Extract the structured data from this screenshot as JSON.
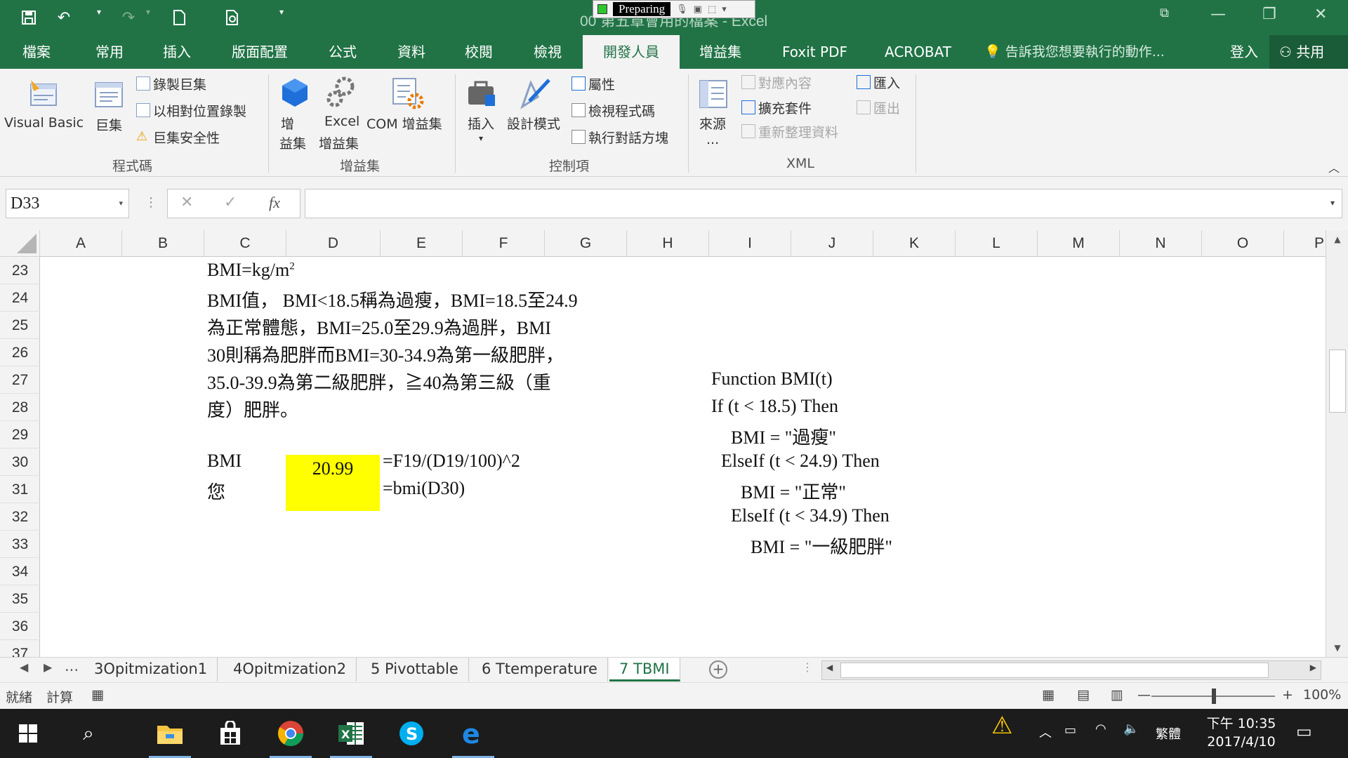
{
  "window": {
    "title": "00 第五章會用的檔案 - Excel",
    "recorder_status": "Preparing"
  },
  "tabs": [
    "檔案",
    "常用",
    "插入",
    "版面配置",
    "公式",
    "資料",
    "校閱",
    "檢視",
    "開發人員",
    "增益集",
    "Foxit PDF",
    "ACROBAT"
  ],
  "active_tab": "開發人員",
  "tell_me": "告訴我您想要執行的動作...",
  "sign_in": "登入",
  "share": "共用",
  "ribbon": {
    "code": {
      "group": "程式碼",
      "visual_basic": "Visual Basic",
      "macros": "巨集",
      "record_macro": "錄製巨集",
      "relative_ref": "以相對位置錄製",
      "macro_security": "巨集安全性"
    },
    "addins": {
      "group": "增益集",
      "addins_line1": "增",
      "addins_line2": "益集",
      "excel_addins_line1": "Excel",
      "excel_addins_line2": "增益集",
      "com_addins": "COM 增益集"
    },
    "controls": {
      "group": "控制項",
      "insert": "插入",
      "design_mode": "設計模式",
      "properties": "屬性",
      "view_code": "檢視程式碼",
      "run_dialog": "執行對話方塊"
    },
    "xml": {
      "group": "XML",
      "source": "來源",
      "source_more": "...",
      "map_properties": "對應內容",
      "expansion_packs": "擴充套件",
      "refresh_data": "重新整理資料",
      "import": "匯入",
      "export": "匯出"
    }
  },
  "formula_bar": {
    "name_box": "D33",
    "formula": "",
    "fx": "fx"
  },
  "columns": [
    "A",
    "B",
    "C",
    "D",
    "E",
    "F",
    "G",
    "H",
    "I",
    "J",
    "K",
    "L",
    "M",
    "N",
    "O",
    "P"
  ],
  "rows": [
    "23",
    "24",
    "25",
    "26",
    "27",
    "28",
    "29",
    "30",
    "31",
    "32",
    "33",
    "34",
    "35",
    "36",
    "37"
  ],
  "cells": {
    "c23_base": "BMI=kg/m",
    "c23_sup": "2",
    "c24": "BMI值， BMI<18.5稱為過瘦，BMI=18.5至24.9",
    "c25": "為正常體態，BMI=25.0至29.9為過胖，BMI",
    "c26": "30則稱為肥胖而BMI=30-34.9為第一級肥胖，",
    "c27": "35.0-39.9為第二級肥胖，≧40為第三級（重",
    "c28": "度）肥胖。",
    "c30_label": "BMI",
    "d30_value": "20.99",
    "e30_formula": "=F19/(D19/100)^2",
    "c31_label": "您",
    "e31_formula": "=bmi(D30)",
    "code_lines": [
      "Function BMI(t)",
      "If (t < 18.5) Then",
      "BMI = \"過瘦\"",
      "ElseIf (t < 24.9) Then",
      "BMI = \"正常\"",
      "ElseIf (t < 34.9) Then",
      "BMI = \"一級肥胖\""
    ]
  },
  "sheet_tabs": [
    "3Opitmization1",
    "4Opitmization2",
    "5 Pivottable",
    "6 Ttemperature",
    "7 TBMI"
  ],
  "active_sheet": "7 TBMI",
  "sheet_more": "...",
  "status": {
    "ready": "就緒",
    "calc": "計算",
    "zoom": "100%"
  },
  "taskbar": {
    "ime": "繁體",
    "time": "下午 10:35",
    "date": "2017/4/10"
  },
  "colors": {
    "excel_green": "#217346",
    "highlight": "#ffff00"
  }
}
